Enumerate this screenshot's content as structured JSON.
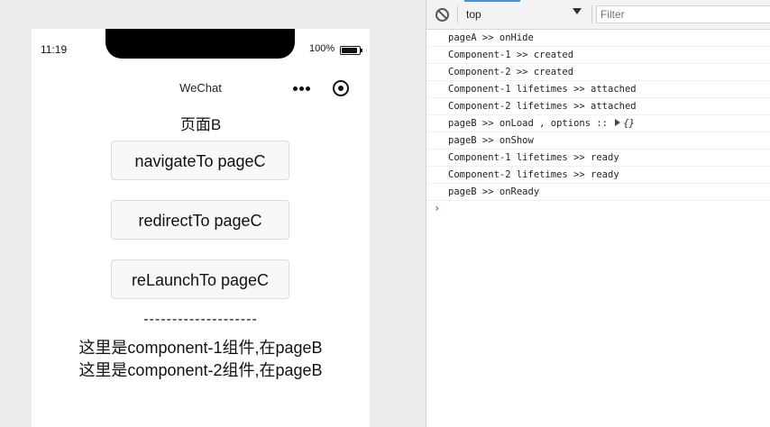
{
  "simulator": {
    "status_time": "11:19",
    "battery_percent": "100%",
    "nav_title": "WeChat",
    "page_title": "页面B",
    "buttons": {
      "navigate": "navigateTo pageC",
      "redirect": "redirectTo pageC",
      "relaunch": "reLaunchTo pageC"
    },
    "divider_text": "--------------------",
    "component_lines": [
      "这里是component-1组件,在pageB",
      "这里是component-2组件,在pageB"
    ]
  },
  "console": {
    "context": "top",
    "filter_placeholder": "Filter",
    "logs": [
      "pageA >> onHide",
      "Component-1 >> created",
      "Component-2 >> created",
      "Component-1 lifetimes >> attached",
      "Component-2 lifetimes >> attached",
      "pageB >> onLoad , options :: ",
      "pageB >> onShow",
      "Component-1 lifetimes >> ready",
      "Component-2 lifetimes >> ready",
      "pageB >> onReady"
    ],
    "options_object": "{}",
    "prompt": "›"
  },
  "colors": {
    "accent": "#4a90d9",
    "prompt": "#2f7bd8"
  }
}
